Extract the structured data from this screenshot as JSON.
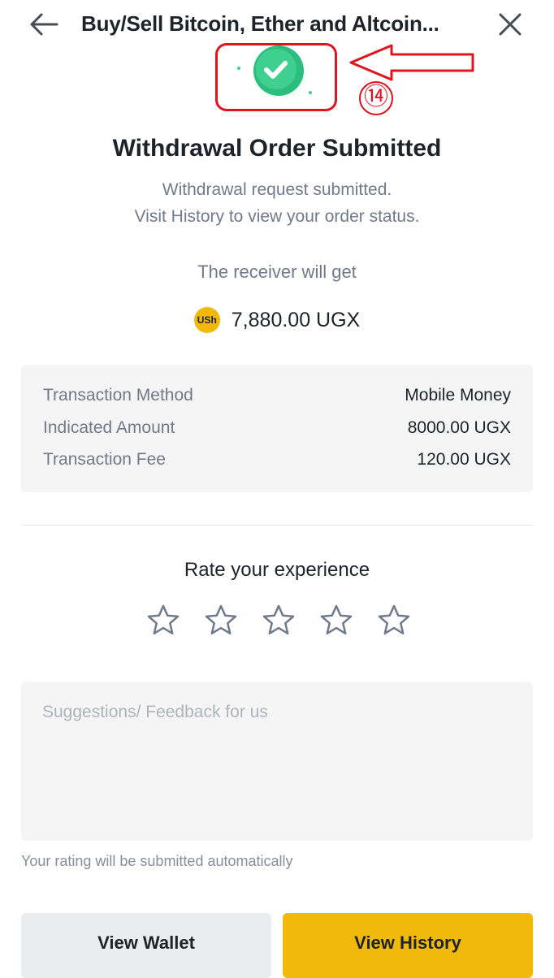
{
  "header": {
    "title": "Buy/Sell Bitcoin, Ether and Altcoin...",
    "back_icon": "arrow-left",
    "close_icon": "close-x"
  },
  "annotation": {
    "number": "⑭",
    "color": "#e0141f"
  },
  "status": {
    "icon": "check-circle",
    "color": "#3fcf8e",
    "title": "Withdrawal Order Submitted",
    "subtitle_line1": "Withdrawal request submitted.",
    "subtitle_line2": "Visit History to view your order status."
  },
  "receiver": {
    "label": "The receiver will get",
    "currency_badge": "USh",
    "amount": "7,880.00 UGX"
  },
  "details": [
    {
      "label": "Transaction Method",
      "value": "Mobile Money"
    },
    {
      "label": "Indicated Amount",
      "value": "8000.00 UGX"
    },
    {
      "label": "Transaction Fee",
      "value": "120.00 UGX"
    }
  ],
  "rating": {
    "title": "Rate your experience",
    "max_stars": 5,
    "selected_stars": 0
  },
  "feedback": {
    "placeholder": "Suggestions/ Feedback for us",
    "value": "",
    "note": "Your rating will be submitted automatically"
  },
  "buttons": {
    "wallet_label": "View Wallet",
    "history_label": "View History"
  },
  "colors": {
    "accent": "#f0b90b",
    "secondary_button": "#eaecef",
    "card_background": "#f5f5f5",
    "primary_text": "#1e2329",
    "muted_text": "#707a8a"
  }
}
